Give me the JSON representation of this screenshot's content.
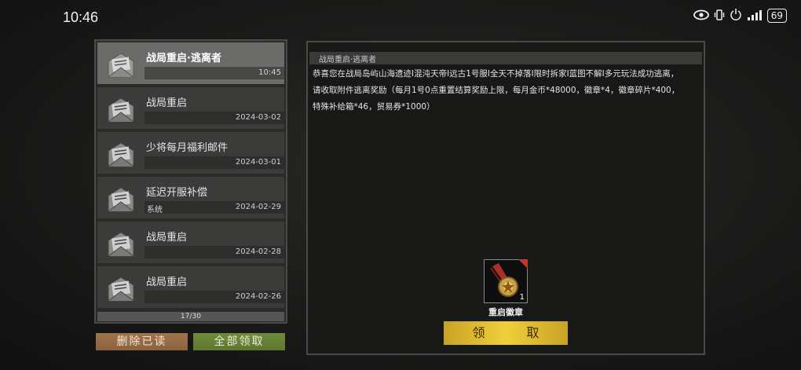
{
  "status_bar": {
    "time": "10:46",
    "battery": "69"
  },
  "mail_list": {
    "pager": "17/30",
    "items": [
      {
        "title": "战局重启·逃离者",
        "sub": "",
        "date": "10:45",
        "selected": true
      },
      {
        "title": "战局重启",
        "sub": "",
        "date": "2024-03-02",
        "selected": false
      },
      {
        "title": "少将每月福利邮件",
        "sub": "",
        "date": "2024-03-01",
        "selected": false
      },
      {
        "title": "延迟开服补偿",
        "sub": "系统",
        "date": "2024-02-29",
        "selected": false
      },
      {
        "title": "战局重启",
        "sub": "",
        "date": "2024-02-28",
        "selected": false
      },
      {
        "title": "战局重启",
        "sub": "",
        "date": "2024-02-26",
        "selected": false
      }
    ]
  },
  "buttons": {
    "delete_read": "删除已读",
    "claim_all": "全部领取",
    "claim": "领 取"
  },
  "detail": {
    "title": "战局重启·逃离者",
    "body_lines": [
      "恭喜您在战局岛屿山海遗迹I混沌天帝I远古1号服I全天不掉落I限时拆家I蓝图不解I多元玩法成功逃离，",
      "请收取附件逃离奖励（每月1号0点重置结算奖励上限，每月金币*48000，徽章*4，徽章碎片*400，",
      "特殊补给箱*46，贸易券*1000）"
    ],
    "attachment": {
      "name": "重启徽章",
      "count": "1",
      "icon": "medal-icon"
    }
  }
}
